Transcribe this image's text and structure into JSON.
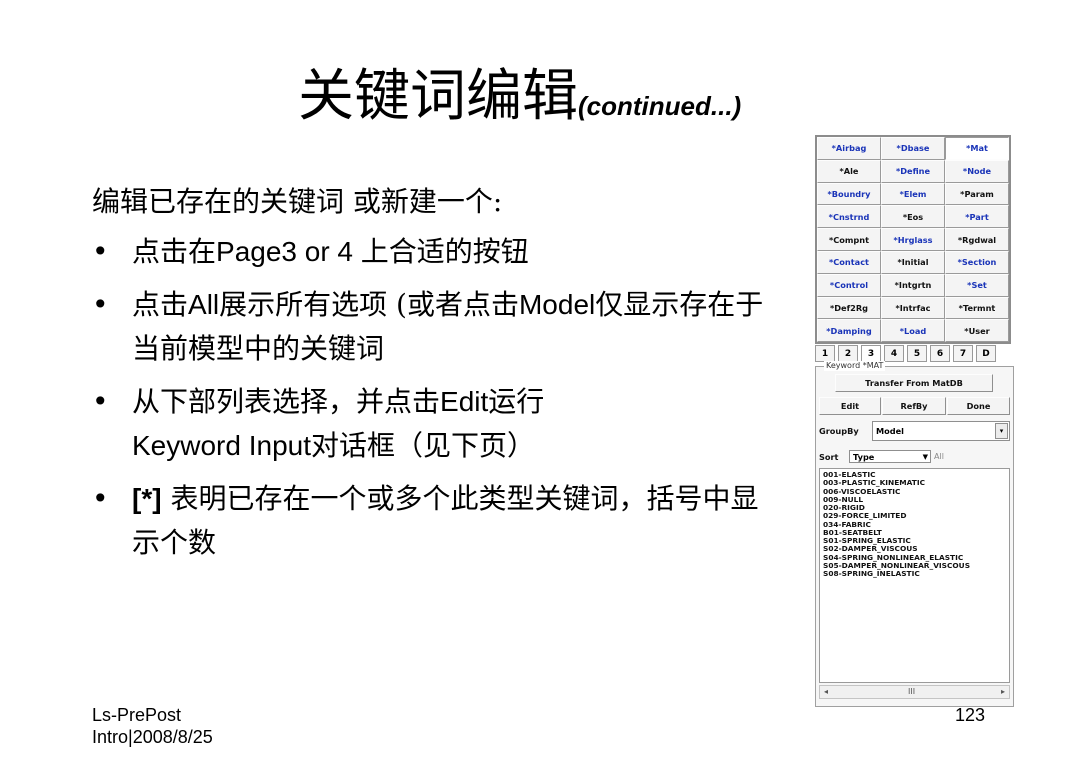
{
  "slide": {
    "title": "关键词编辑",
    "title_suffix": "(continued...)",
    "intro": "编辑已存在的关键词 或新建一个:",
    "bullet_symbol": "•",
    "bullets": [
      {
        "segments": [
          "点击在",
          "Page3 or 4 ",
          "上合适的按钮"
        ]
      },
      {
        "segments": [
          "点击",
          "All",
          "展示所有选项 (或者点击",
          "Model",
          "仅显示存在于当前模型中的关键词"
        ]
      },
      {
        "segments": [
          "从下部列表选择，并点击",
          "Edit",
          "运行",
          "Keyword Input",
          "对话框（见下页）"
        ]
      },
      {
        "segments": [
          "[*]",
          " 表明已存在一个或多个此类型关键词，括号中显示个数"
        ]
      }
    ],
    "footer_left_1": "Ls-PrePost",
    "footer_left_2": "Intro|2008/8/25",
    "page_number": "123"
  },
  "panel": {
    "keyword_buttons": [
      "*Airbag",
      "*Dbase",
      "*Mat",
      "*Ale",
      "*Define",
      "*Node",
      "*Boundry",
      "*Elem",
      "*Param",
      "*Cnstrnd",
      "*Eos",
      "*Part",
      "*Compnt",
      "*Hrglass",
      "*Rgdwal",
      "*Contact",
      "*Initial",
      "*Section",
      "*Control",
      "*Intgrtn",
      "*Set",
      "*Def2Rg",
      "*Intrfac",
      "*Termnt",
      "*Damping",
      "*Load",
      "*User"
    ],
    "page_tabs": [
      "1",
      "2",
      "3",
      "4",
      "5",
      "6",
      "7",
      "D"
    ],
    "group_legend": "Keyword *MAT",
    "transfer_label": "Transfer From MatDB",
    "edit_label": "Edit",
    "refby_label": "RefBy",
    "done_label": "Done",
    "groupby_label": "GroupBy",
    "groupby_value": "Model",
    "sort_label": "Sort",
    "sort_value": "Type",
    "all_label": "All",
    "keyword_list": [
      "001-ELASTIC",
      "003-PLASTIC_KINEMATIC",
      "006-VISCOELASTIC",
      "009-NULL",
      "020-RIGID",
      "029-FORCE_LIMITED",
      "034-FABRIC",
      "B01-SEATBELT",
      "S01-SPRING_ELASTIC",
      "S02-DAMPER_VISCOUS",
      "S04-SPRING_NONLINEAR_ELASTIC",
      "S05-DAMPER_NONLINEAR_VISCOUS",
      "S08-SPRING_INELASTIC"
    ],
    "scroll_left": "◂",
    "scroll_mid": "III",
    "scroll_right": "▸"
  },
  "colors": {
    "button_text_blue": "#1a34b8",
    "button_text_dark": "#111111",
    "panel_bg": "#f2f2f2"
  }
}
